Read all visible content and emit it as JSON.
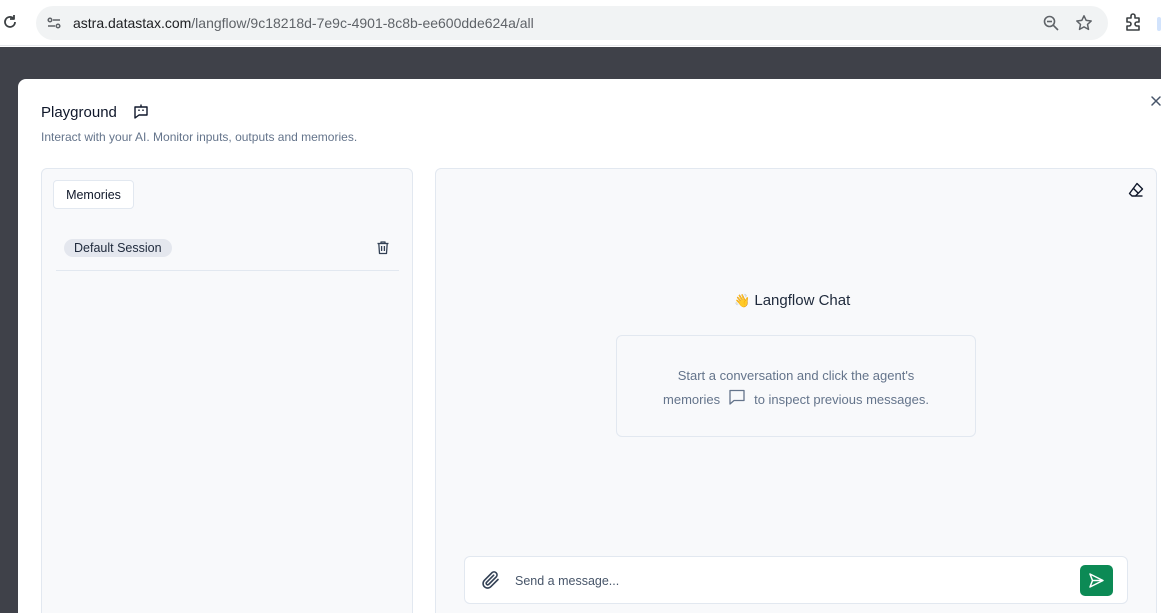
{
  "browser": {
    "url_domain": "astra.datastax.com",
    "url_path": "/langflow/9c18218d-7e9c-4901-8c8b-ee600dde624a/all"
  },
  "modal": {
    "title": "Playground",
    "description": "Interact with your AI. Monitor inputs, outputs and memories."
  },
  "memories": {
    "button_label": "Memories",
    "sessions": [
      {
        "label": "Default Session"
      }
    ]
  },
  "chat": {
    "emoji": "👋",
    "title": "Langflow Chat",
    "hint_line1": "Start a conversation and click the agent's",
    "hint_line2_before": "memories",
    "hint_line2_after": "to inspect previous messages.",
    "input_placeholder": "Send a message..."
  },
  "colors": {
    "send_button": "#0c8a55",
    "backdrop": "#3f4149"
  }
}
